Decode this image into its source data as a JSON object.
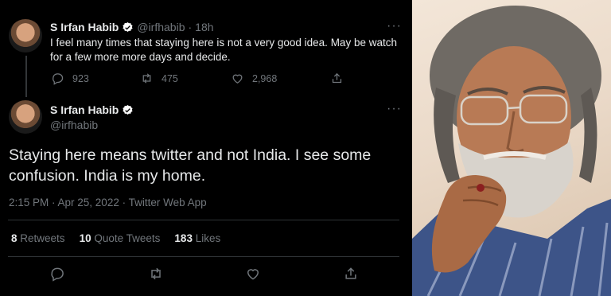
{
  "tweet1": {
    "name": "S Irfan Habib",
    "handle": "@irfhabib",
    "time": "18h",
    "text": "I feel many times that staying here is not a very good idea. May be watch for a few more more days and decide.",
    "replies": "923",
    "retweets": "475",
    "likes": "2,968"
  },
  "tweet2": {
    "name": "S Irfan Habib",
    "handle": "@irfhabib",
    "text": "Staying here means twitter and not India. I see some confusion. India is my home.",
    "timestamp": "2:15 PM · Apr 25, 2022 · Twitter Web App",
    "stats": {
      "retweets_num": "8",
      "retweets_label": "Retweets",
      "quotes_num": "10",
      "quotes_label": "Quote Tweets",
      "likes_num": "183",
      "likes_label": "Likes"
    }
  },
  "icons": [
    "verified-badge-icon",
    "more-icon",
    "reply-icon",
    "retweet-icon",
    "like-icon",
    "share-icon"
  ],
  "colors": {
    "background": "#000000",
    "text": "#e7e9ea",
    "muted": "#71767b",
    "verified": "#ffffff"
  }
}
